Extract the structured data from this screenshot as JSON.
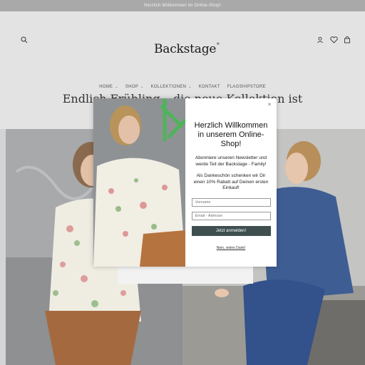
{
  "announcement": "Herzlich Willkommen im Online-Shop!",
  "header": {
    "logo": "Backstage",
    "logo_mark": "®",
    "headline": "Endlich Frühling – die neue Kollektion ist"
  },
  "nav": [
    {
      "label": "HOME",
      "chevron": "⌄"
    },
    {
      "label": "SHOP",
      "chevron": "⌄"
    },
    {
      "label": "KOLLEKTIONEN",
      "chevron": "⌄"
    },
    {
      "label": "KONTAKT",
      "chevron": ""
    },
    {
      "label": "FLAGSHIPSTORE",
      "chevron": ""
    }
  ],
  "icons": {
    "search": "search-icon",
    "account": "account-icon",
    "wishlist": "heart-icon",
    "cart": "cart-icon",
    "close": "close-icon"
  },
  "popup": {
    "close": "×",
    "title": "Herzlich Willkommen in unserem Online-Shop!",
    "text": "Abonniere unseren Newsletter und werde Teil der Backstage - Family!",
    "text2": "Als Dankeschön schenken wir Dir einen 10% Rabatt auf Deinen ersten Einkauf!",
    "name_placeholder": "Vorname",
    "email_placeholder": "Email - Adresse",
    "submit": "Jetzt anmelden!",
    "decline": "Nein, vielen Dank!"
  },
  "colors": {
    "announcement_bg": "#a9a9a9",
    "header_bg": "#e3e3e3",
    "button_bg": "#3f4f50"
  }
}
